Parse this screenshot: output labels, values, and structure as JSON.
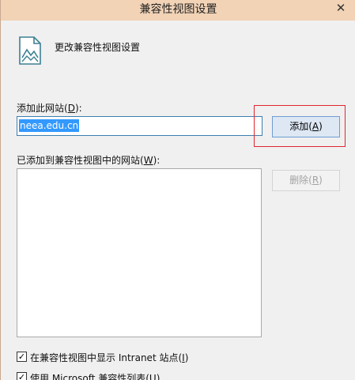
{
  "window": {
    "title": "兼容性视图设置",
    "close_glyph": "✕"
  },
  "header": {
    "text": "更改兼容性视图设置"
  },
  "add_section": {
    "label_prefix": "添加此网站(",
    "label_accesskey": "D",
    "label_suffix": "):",
    "input_value": "neea.edu.cn",
    "add_button_prefix": "添加(",
    "add_button_accesskey": "A",
    "add_button_suffix": ")"
  },
  "list_section": {
    "label_prefix": "已添加到兼容性视图中的网站(",
    "label_accesskey": "W",
    "label_suffix": "):",
    "remove_button_prefix": "删除(",
    "remove_button_accesskey": "R",
    "remove_button_suffix": ")",
    "sites": []
  },
  "options": [
    {
      "checked": true,
      "label_prefix": "在兼容性视图中显示 Intranet 站点(",
      "label_accesskey": "I",
      "label_suffix": ")"
    },
    {
      "checked": true,
      "label_prefix": "使用 Microsoft 兼容性列表(",
      "label_accesskey": "U",
      "label_suffix": ")"
    }
  ],
  "icons": {
    "header": "document-picture-icon",
    "close": "close-icon",
    "checkmark": "✓"
  },
  "colors": {
    "titlebar": "#f2d3b6",
    "selection": "#3399ff",
    "highlight": "#e0262f",
    "input_border": "#3c7fb1"
  }
}
